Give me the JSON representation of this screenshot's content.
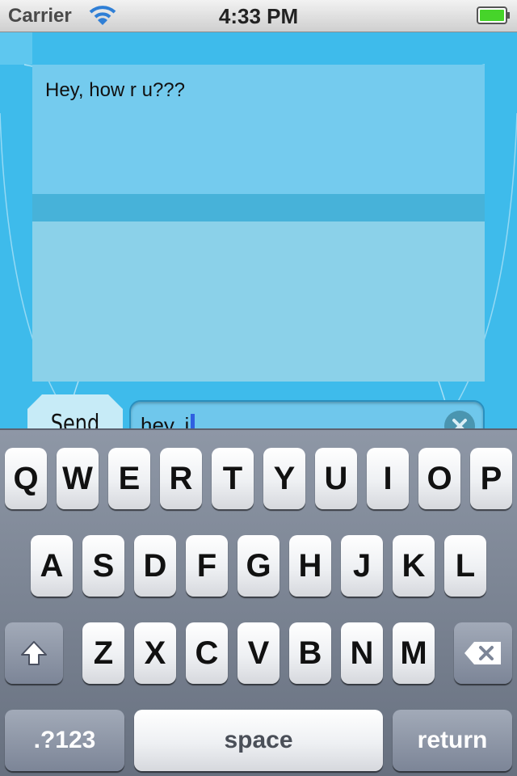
{
  "status_bar": {
    "carrier": "Carrier",
    "time": "4:33 PM"
  },
  "chat": {
    "received_message": "Hey, how r u???",
    "send_label": "Send",
    "input_value": "hey, i"
  },
  "keyboard": {
    "row1": [
      "Q",
      "W",
      "E",
      "R",
      "T",
      "Y",
      "U",
      "I",
      "O",
      "P"
    ],
    "row2": [
      "A",
      "S",
      "D",
      "F",
      "G",
      "H",
      "J",
      "K",
      "L"
    ],
    "row3": [
      "Z",
      "X",
      "C",
      "V",
      "B",
      "N",
      "M"
    ],
    "numbers_label": ".?123",
    "space_label": "space",
    "return_label": "return"
  },
  "colors": {
    "accent_blue": "#3ebbeb",
    "panel_blue": "#8bd1e9",
    "battery_green": "#46d42a"
  }
}
